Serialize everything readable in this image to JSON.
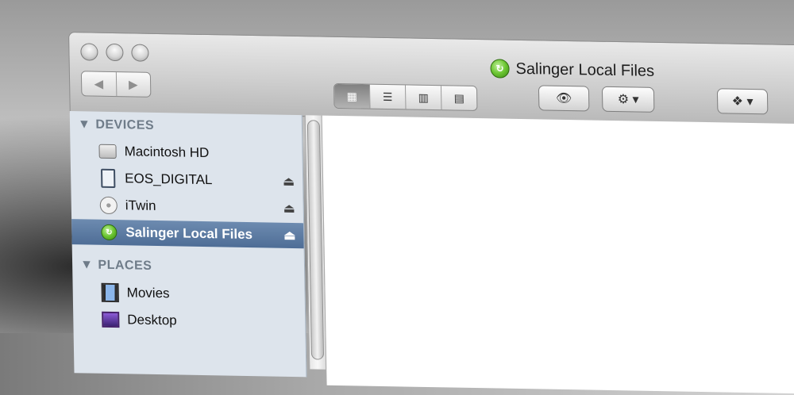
{
  "window": {
    "title": "Salinger Local Files"
  },
  "toolbar": {
    "nav_back_icon": "◀",
    "nav_forward_icon": "▶",
    "view_icon_labels": [
      "icon-view",
      "list-view",
      "column-view",
      "coverflow-view"
    ],
    "eye_label": "👁",
    "gear_label": "⚙ ▾",
    "dropbox_label": "❖ ▾"
  },
  "sidebar": {
    "devices_header": "DEVICES",
    "places_header": "PLACES",
    "devices": [
      {
        "label": "Macintosh HD"
      },
      {
        "label": "EOS_DIGITAL"
      },
      {
        "label": "iTwin"
      },
      {
        "label": "Salinger Local Files"
      }
    ],
    "places": [
      {
        "label": "Movies"
      },
      {
        "label": "Desktop"
      }
    ]
  },
  "icons": {
    "eject": "⏏",
    "disclosure": "▼",
    "grid": "▦",
    "list": "☰",
    "columns": "▥",
    "coverflow": "▤"
  }
}
